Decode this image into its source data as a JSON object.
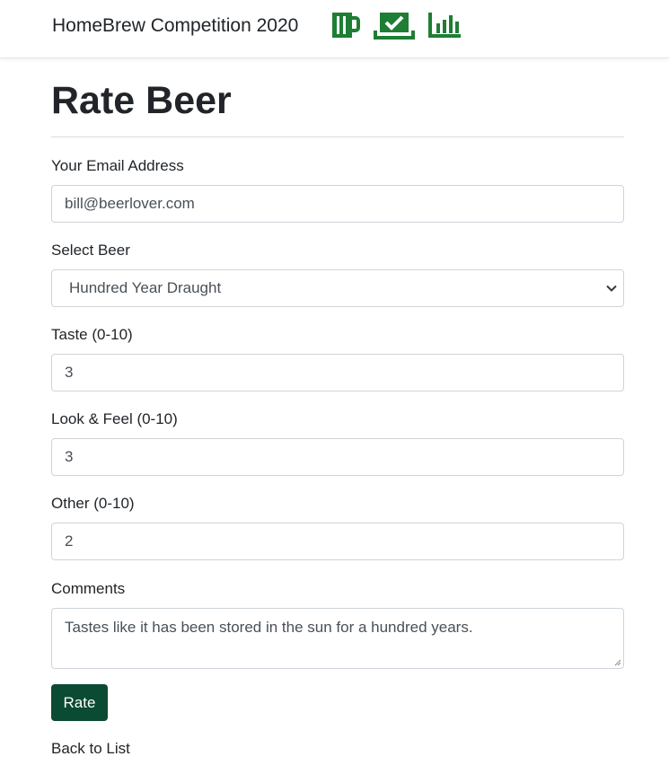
{
  "navbar": {
    "brand": "HomeBrew Competition 2020",
    "icons": [
      "beer-mug-icon",
      "vote-check-icon",
      "results-chart-icon"
    ],
    "icon_color": "#1e7e34"
  },
  "page": {
    "title": "Rate Beer"
  },
  "form": {
    "email": {
      "label": "Your Email Address",
      "value": "bill@beerlover.com"
    },
    "beer": {
      "label": "Select Beer",
      "selected": "Hundred Year Draught"
    },
    "taste": {
      "label": "Taste (0-10)",
      "value": "3"
    },
    "look": {
      "label": "Look & Feel (0-10)",
      "value": "3"
    },
    "other": {
      "label": "Other (0-10)",
      "value": "2"
    },
    "comments": {
      "label": "Comments",
      "value": "Tastes like it has been stored in the sun for a hundred years."
    },
    "submit_label": "Rate",
    "submit_color": "#0b4a33"
  },
  "links": {
    "back": "Back to List"
  }
}
